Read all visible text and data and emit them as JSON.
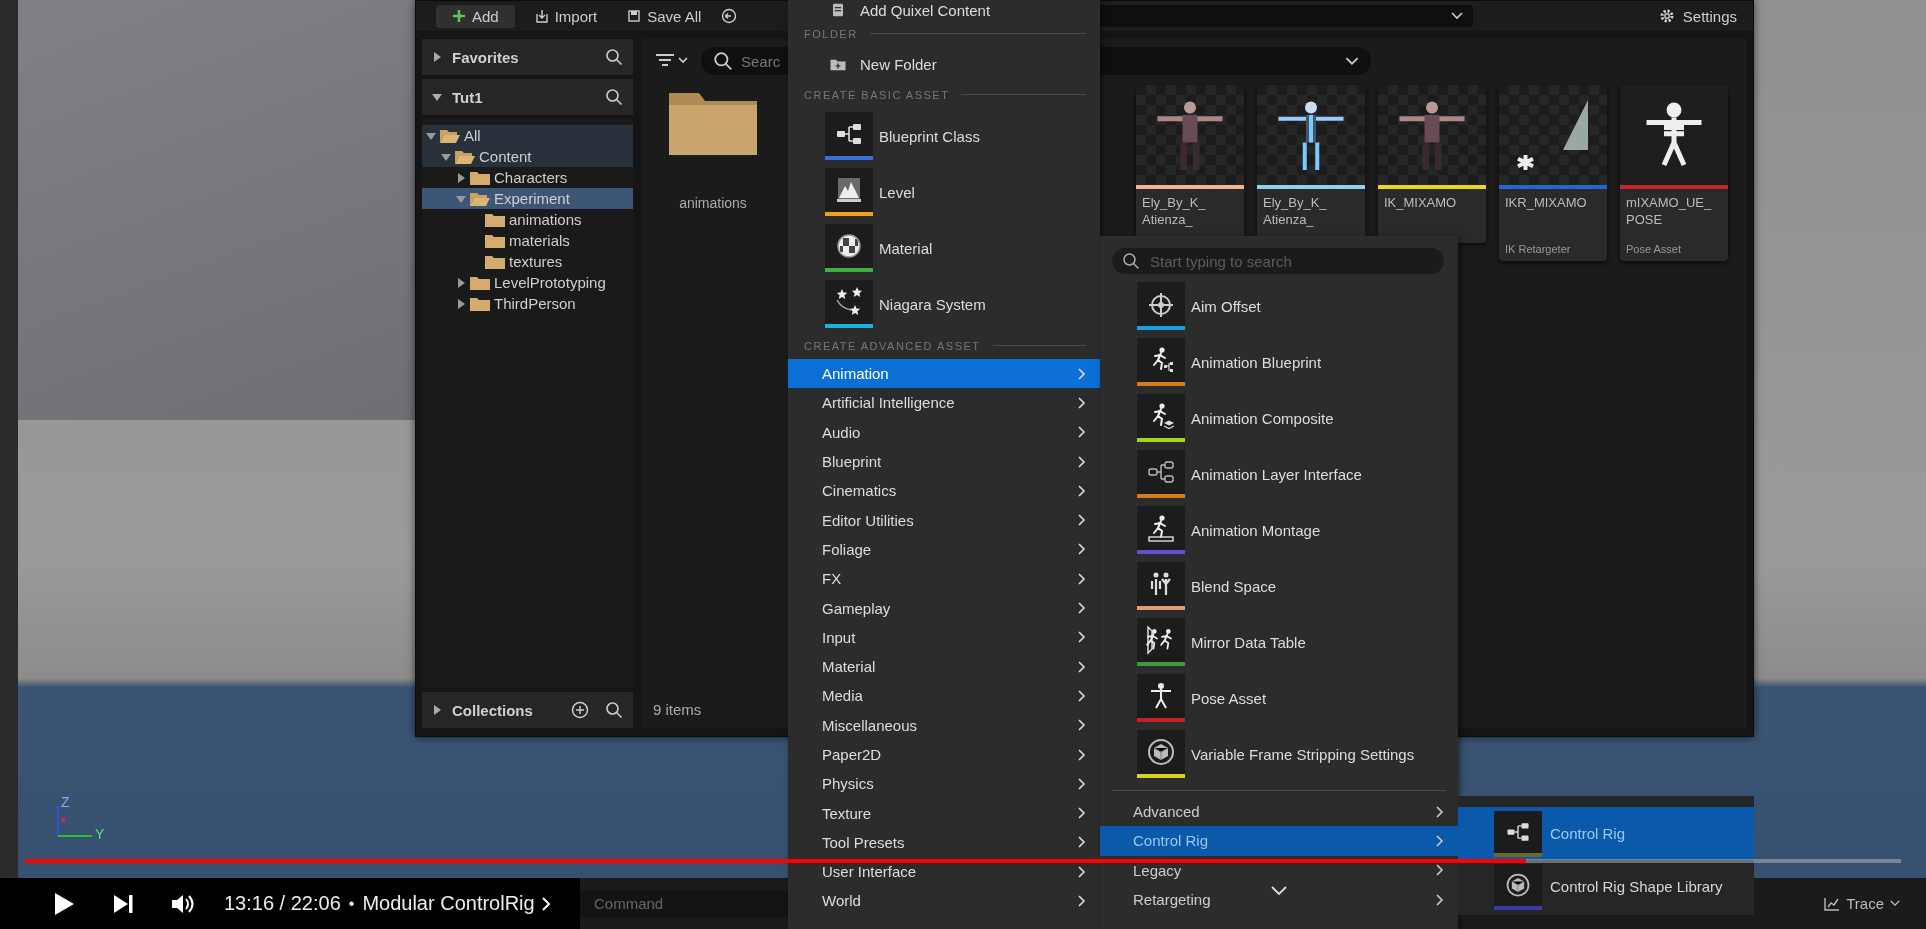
{
  "viewport": {
    "axis_labels": [
      "Z",
      "Y"
    ]
  },
  "content_browser": {
    "toolbar": {
      "buttons": [
        {
          "label": "Add",
          "kind": "add"
        },
        {
          "label": "Import",
          "kind": "import"
        },
        {
          "label": "Save All",
          "kind": "save"
        }
      ],
      "settings": "Settings"
    },
    "favorites": {
      "label": "Favorites",
      "expanded": false
    },
    "source": {
      "label": "Tut1",
      "expanded": true
    },
    "tree": [
      {
        "label": "All",
        "expanded": true,
        "selected": false,
        "in_path": true,
        "children": [
          {
            "label": "Content",
            "expanded": true,
            "selected": false,
            "in_path": true,
            "children": [
              {
                "label": "Characters",
                "expanded": false,
                "selected": false,
                "in_path": false
              },
              {
                "label": "Experiment",
                "expanded": true,
                "selected": true,
                "in_path": false,
                "children": [
                  {
                    "label": "animations",
                    "selected": false,
                    "in_path": false
                  },
                  {
                    "label": "materials",
                    "selected": false,
                    "in_path": false
                  },
                  {
                    "label": "textures",
                    "selected": false,
                    "in_path": false
                  }
                ]
              },
              {
                "label": "LevelPrototyping",
                "expanded": false,
                "selected": false,
                "in_path": false
              },
              {
                "label": "ThirdPerson",
                "expanded": false,
                "selected": false,
                "in_path": false
              }
            ]
          }
        ]
      }
    ],
    "collections": {
      "label": "Collections",
      "expanded": false
    },
    "search": {
      "placeholder": "Searc"
    },
    "folders": [
      {
        "label": "animations"
      }
    ],
    "assets": [
      {
        "name": "Ely_By_K_ Atienza_",
        "color": "#f2b48e"
      },
      {
        "name": "Ely_By_K_ Atienza_",
        "color": "#8fd0ea"
      },
      {
        "name": "IK_MIXAMO",
        "color": "#ecd51c"
      },
      {
        "name": "IKR_MIXAMO",
        "type": "IK Retargeter",
        "color": "#2566d6"
      },
      {
        "name": "mIXAMO_UE_ POSE",
        "type": "Pose Asset",
        "color": "#c8262b"
      }
    ],
    "item_count": "9 items"
  },
  "add_menu": {
    "top_item": {
      "label": "Add Quixel Content"
    },
    "folder_header": "FOLDER",
    "folder_items": [
      {
        "label": "New Folder"
      }
    ],
    "basic_header": "CREATE BASIC ASSET",
    "basic_items": [
      {
        "label": "Blueprint Class",
        "color": "#3c6fd8"
      },
      {
        "label": "Level",
        "color": "#f0a020"
      },
      {
        "label": "Material",
        "color": "#3cb043"
      },
      {
        "label": "Niagara System",
        "color": "#1ab0e0"
      }
    ],
    "advanced_header": "CREATE ADVANCED ASSET",
    "categories": [
      {
        "label": "Animation",
        "selected": true
      },
      {
        "label": "Artificial Intelligence",
        "selected": false
      },
      {
        "label": "Audio",
        "selected": false
      },
      {
        "label": "Blueprint",
        "selected": false
      },
      {
        "label": "Cinematics",
        "selected": false
      },
      {
        "label": "Editor Utilities",
        "selected": false
      },
      {
        "label": "Foliage",
        "selected": false
      },
      {
        "label": "FX",
        "selected": false
      },
      {
        "label": "Gameplay",
        "selected": false
      },
      {
        "label": "Input",
        "selected": false
      },
      {
        "label": "Material",
        "selected": false
      },
      {
        "label": "Media",
        "selected": false
      },
      {
        "label": "Miscellaneous",
        "selected": false
      },
      {
        "label": "Paper2D",
        "selected": false
      },
      {
        "label": "Physics",
        "selected": false
      },
      {
        "label": "Texture",
        "selected": false
      },
      {
        "label": "Tool Presets",
        "selected": false
      },
      {
        "label": "User Interface",
        "selected": false
      },
      {
        "label": "World",
        "selected": false
      }
    ]
  },
  "animation_menu": {
    "search": {
      "placeholder": "Start typing to search"
    },
    "items": [
      {
        "label": "Aim Offset",
        "color": "#1aa0e0"
      },
      {
        "label": "Animation Blueprint",
        "color": "#e07818"
      },
      {
        "label": "Animation Composite",
        "color": "#a8d420"
      },
      {
        "label": "Animation Layer Interface",
        "color": "#e07818"
      },
      {
        "label": "Animation Montage",
        "color": "#6050d0"
      },
      {
        "label": "Blend Space",
        "color": "#e89870"
      },
      {
        "label": "Mirror Data Table",
        "color": "#3c9c3c"
      },
      {
        "label": "Pose Asset",
        "color": "#c82020"
      },
      {
        "label": "Variable Frame Stripping Settings",
        "color": "#d4d420"
      }
    ],
    "categories": [
      {
        "label": "Advanced",
        "selected": false
      },
      {
        "label": "Control Rig",
        "selected": true
      },
      {
        "label": "Legacy",
        "selected": false
      },
      {
        "label": "Retargeting",
        "selected": false
      }
    ]
  },
  "control_rig_menu": {
    "items": [
      {
        "label": "Control Rig",
        "color": "#6a6a22",
        "selected": true
      },
      {
        "label": "Control Rig Shape Library",
        "color": "#3a3aa8",
        "selected": false
      }
    ]
  },
  "status_bar": {
    "command": {
      "placeholder": "Command"
    },
    "trace": "Trace"
  },
  "player": {
    "progress": {
      "level": 0.8
    },
    "time": "13:16 / 22:06",
    "separator": "•",
    "chapter": "Modular ControlRig"
  }
}
